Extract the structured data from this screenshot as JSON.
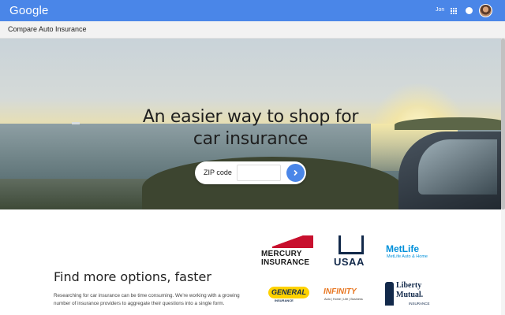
{
  "header": {
    "logo_text": "Google",
    "user_name": "Jon",
    "brand_color": "#4a86e8",
    "icons": [
      "apps-grid-icon",
      "notification-icon",
      "avatar"
    ]
  },
  "subheader": {
    "title": "Compare Auto Insurance"
  },
  "hero": {
    "headline_line1": "An easier way to shop for",
    "headline_line2": "car insurance",
    "zip_label": "ZIP code",
    "zip_value": "",
    "zip_placeholder": "",
    "submit_icon": "chevron-right-icon"
  },
  "content": {
    "section_title": "Find more options, faster",
    "section_body": "Researching for car insurance can be time consuming. We're working with a growing number of insurance providers to aggregate their questions into a single form."
  },
  "partners": {
    "mercury": {
      "line1": "MERCURY",
      "line2": "INSURANCE"
    },
    "usaa": {
      "name": "USAA"
    },
    "metlife": {
      "name": "MetLife",
      "tagline": "MetLife Auto & Home"
    },
    "general": {
      "name": "GENERAL",
      "tagline": "INSURANCE"
    },
    "infinity": {
      "name": "INFINITY",
      "tagline": "Auto | Home | Life | Business"
    },
    "liberty": {
      "line1": "Liberty",
      "line2": "Mutual.",
      "tagline": "INSURANCE"
    }
  }
}
